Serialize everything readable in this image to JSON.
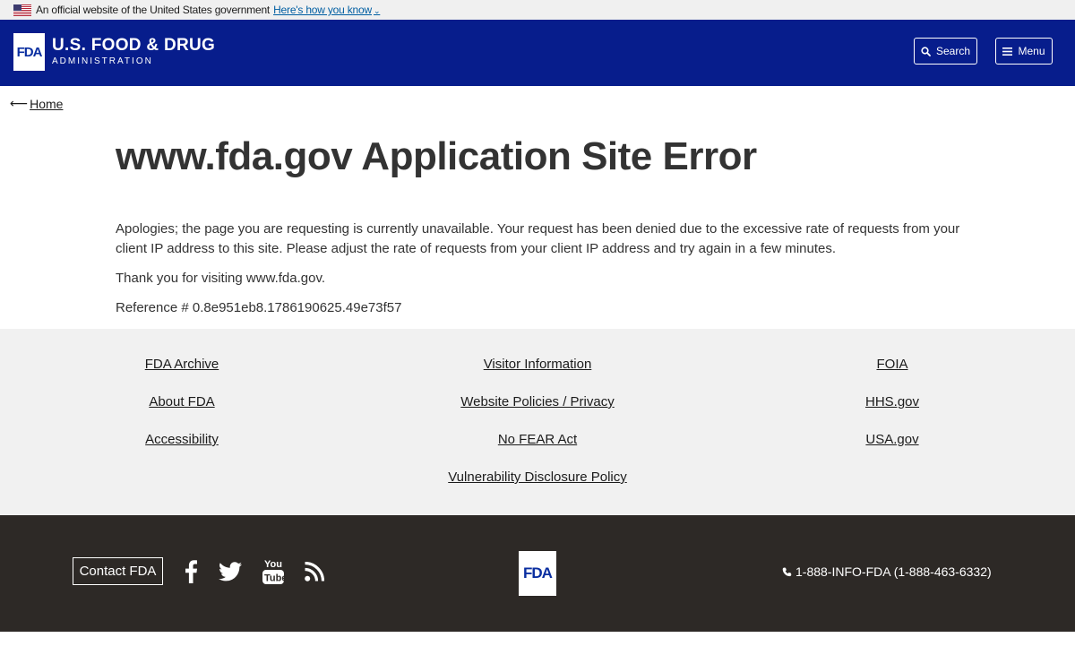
{
  "gov_banner": {
    "official_text": "An official website of the United States government",
    "how_link": "Here's how you know"
  },
  "header": {
    "logo_mark": "FDA",
    "logo_line1": "U.S. FOOD & DRUG",
    "logo_line2": "ADMINISTRATION",
    "search_label": "Search",
    "menu_label": "Menu"
  },
  "breadcrumb": {
    "home_label": "Home"
  },
  "main": {
    "title": "www.fda.gov Application Site Error",
    "paragraph1": "Apologies; the page you are requesting is currently unavailable. Your request has been denied due to the excessive rate of requests from your client IP address to this site. Please adjust the rate of requests from your client IP address and try again in a few minutes.",
    "paragraph2": "Thank you for visiting www.fda.gov.",
    "reference": "Reference # 0.8e951eb8.1786190625.49e73f57"
  },
  "footer_links": {
    "col1": [
      "FDA Archive",
      "About FDA",
      "Accessibility"
    ],
    "col2": [
      "Visitor Information",
      "Website Policies / Privacy",
      "No FEAR Act",
      "Vulnerability Disclosure Policy"
    ],
    "col3": [
      "FOIA",
      "HHS.gov",
      "USA.gov"
    ]
  },
  "footer": {
    "contact_label": "Contact FDA",
    "social_icons": [
      "facebook-icon",
      "twitter-icon",
      "youtube-icon",
      "rss-icon"
    ],
    "logo_mark": "FDA",
    "phone_text": "1-888-INFO-FDA (1-888-463-6332)"
  },
  "colors": {
    "header_bg": "#071d8c",
    "footer_links_bg": "#f1f1f1",
    "footer_dark_bg": "#2d2926",
    "link_blue": "#005ea2"
  }
}
